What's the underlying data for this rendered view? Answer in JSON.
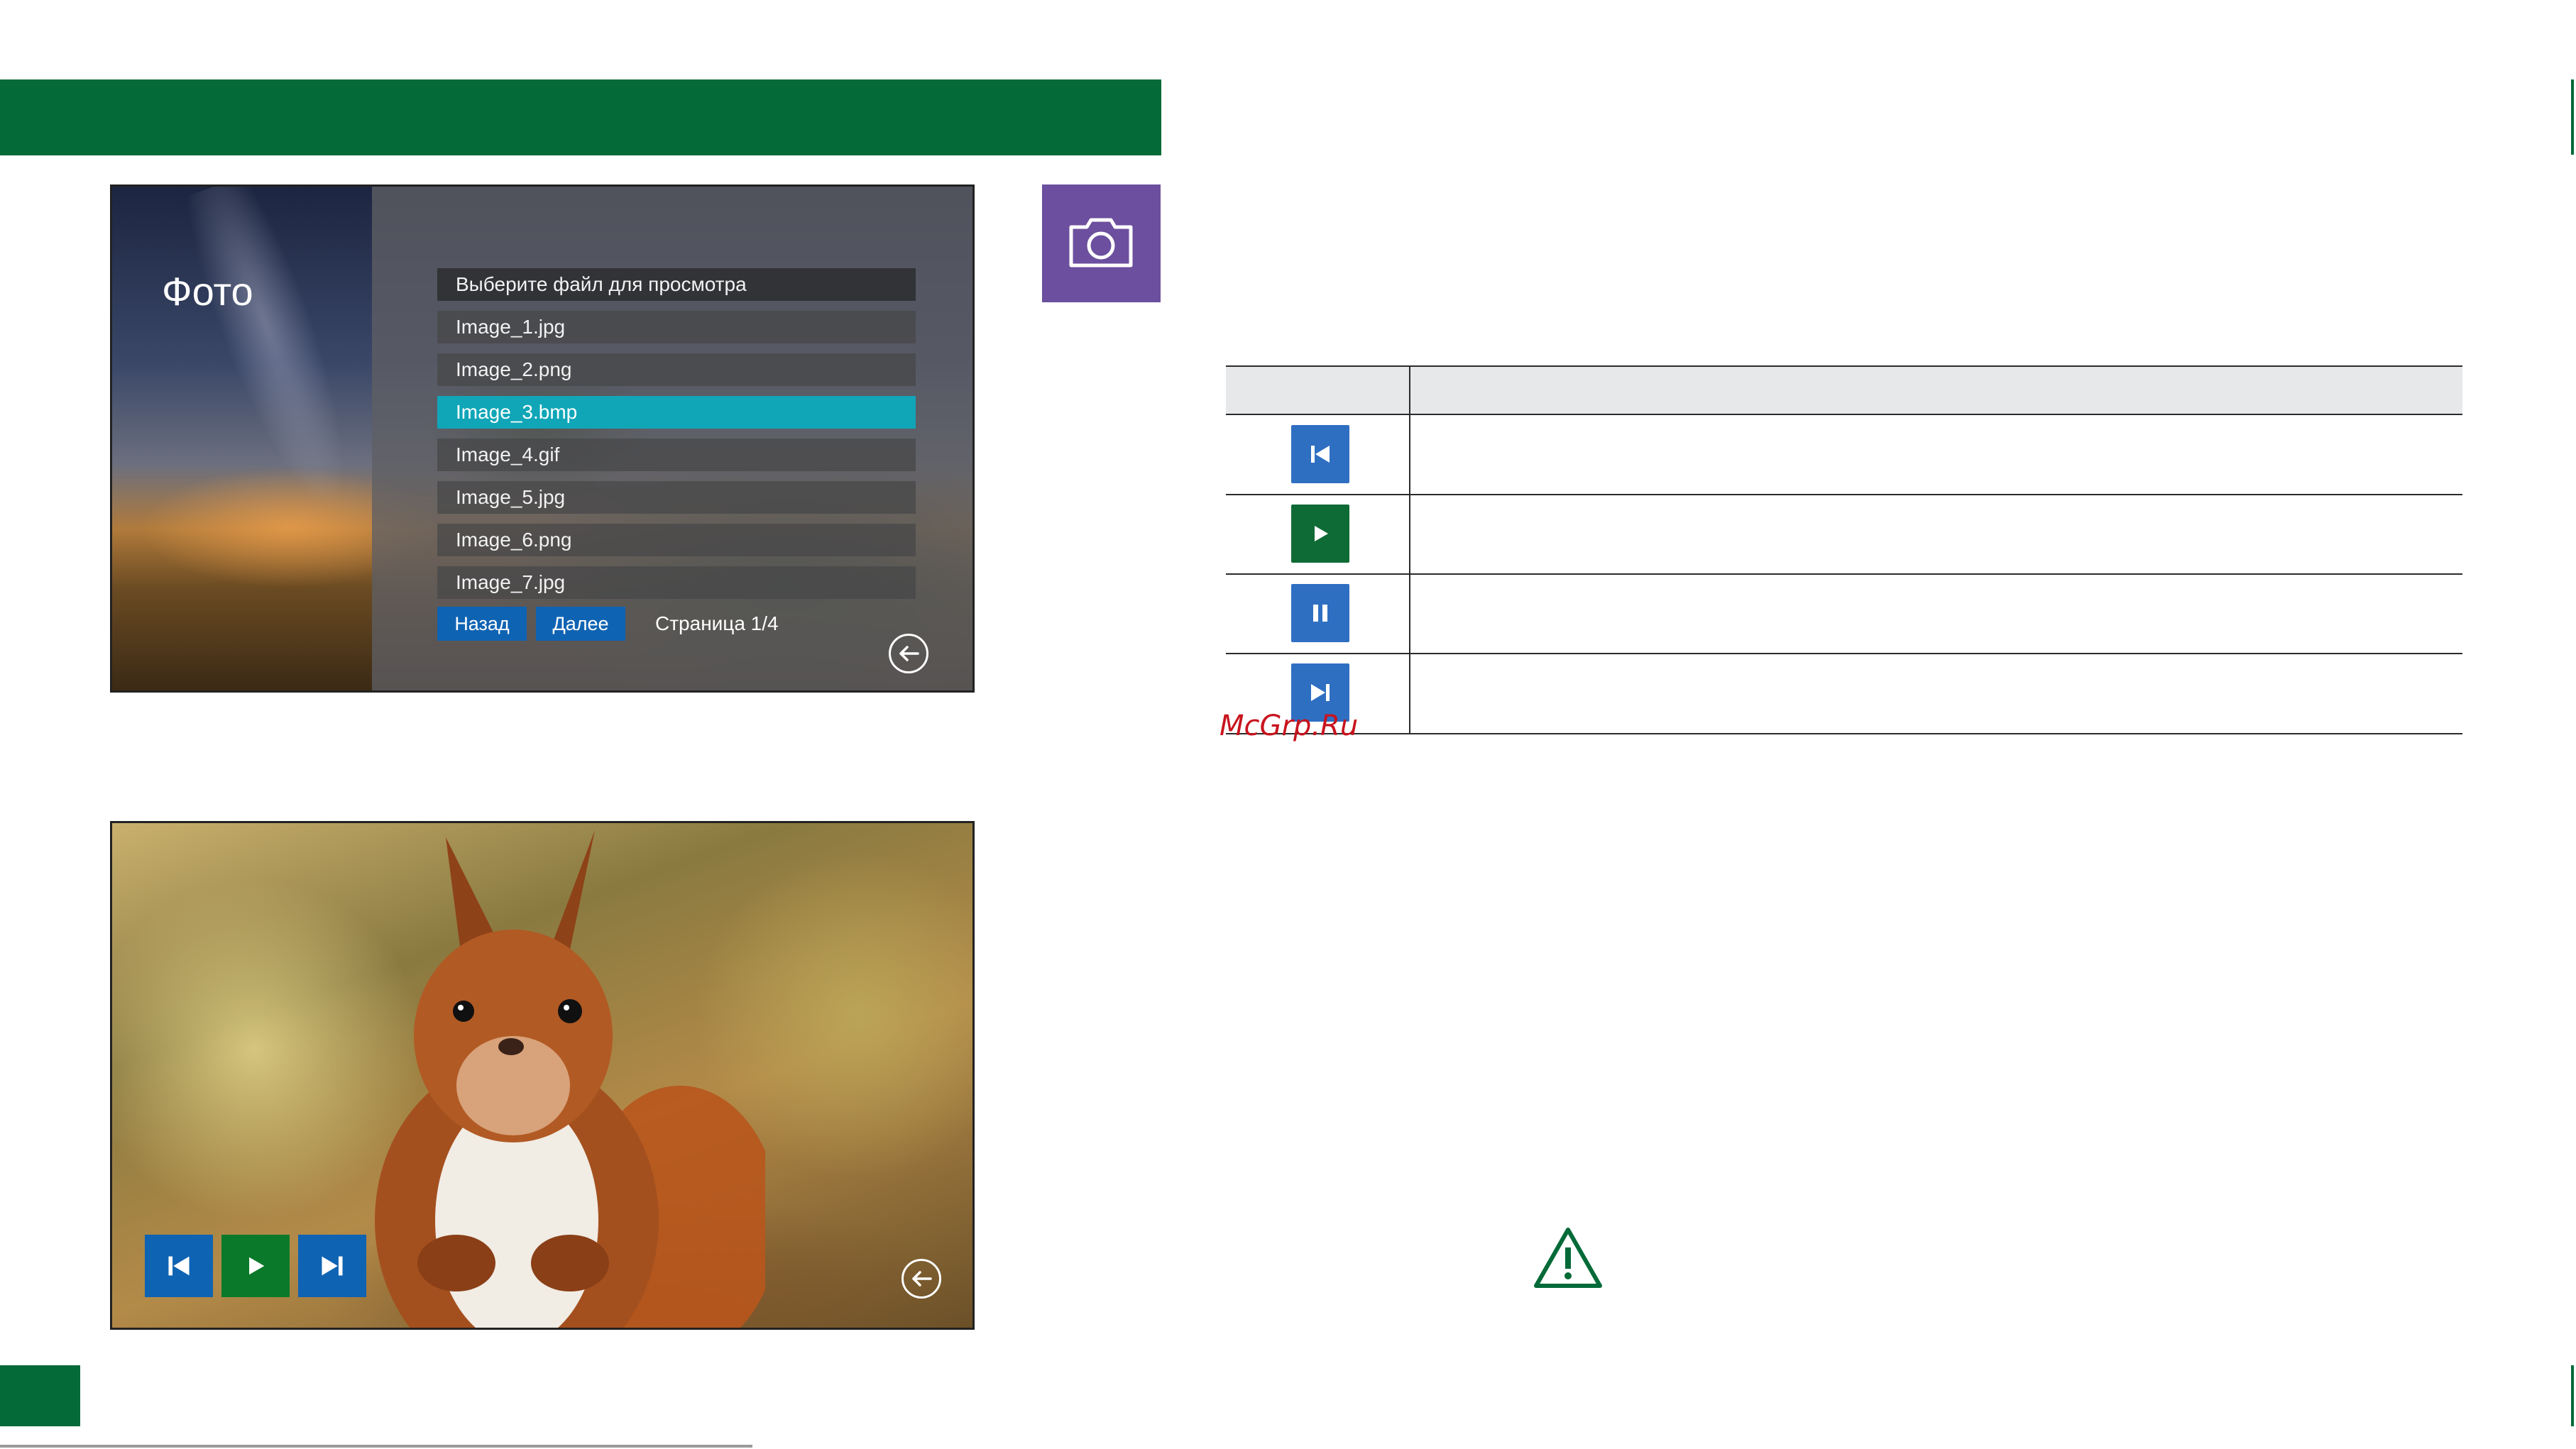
{
  "screen_files": {
    "title": "Фото",
    "list_header": "Выберите файл для просмотра",
    "files": [
      "Image_1.jpg",
      "Image_2.png",
      "Image_3.bmp",
      "Image_4.gif",
      "Image_5.jpg",
      "Image_6.png",
      "Image_7.jpg"
    ],
    "selected_file": "Image_3.bmp",
    "back_label": "Назад",
    "next_label": "Далее",
    "page_indicator": "Страница 1/4",
    "back_icon": "arrow-left-circle-icon"
  },
  "camera_tile": {
    "icon": "camera-icon",
    "color": "#6c4f9e"
  },
  "controls_table": {
    "rows": [
      {
        "icon": "skip-previous-icon",
        "color": "#2f6fc2"
      },
      {
        "icon": "play-icon",
        "color": "#0f6b35"
      },
      {
        "icon": "pause-icon",
        "color": "#2f6fc2"
      },
      {
        "icon": "skip-next-icon",
        "color": "#2f6fc2"
      }
    ]
  },
  "watermark": "McGrp.Ru",
  "screen_photo": {
    "controls": [
      {
        "icon": "skip-previous-icon",
        "color": "#0f63b3"
      },
      {
        "icon": "play-icon",
        "color": "#0a7a2a"
      },
      {
        "icon": "skip-next-icon",
        "color": "#0f63b3"
      }
    ],
    "back_icon": "arrow-left-circle-icon"
  },
  "colors": {
    "brand_green": "#036a38",
    "accent_teal": "#10a6b8",
    "button_blue": "#0f63b3"
  },
  "warning_icon": "warning-triangle-icon"
}
